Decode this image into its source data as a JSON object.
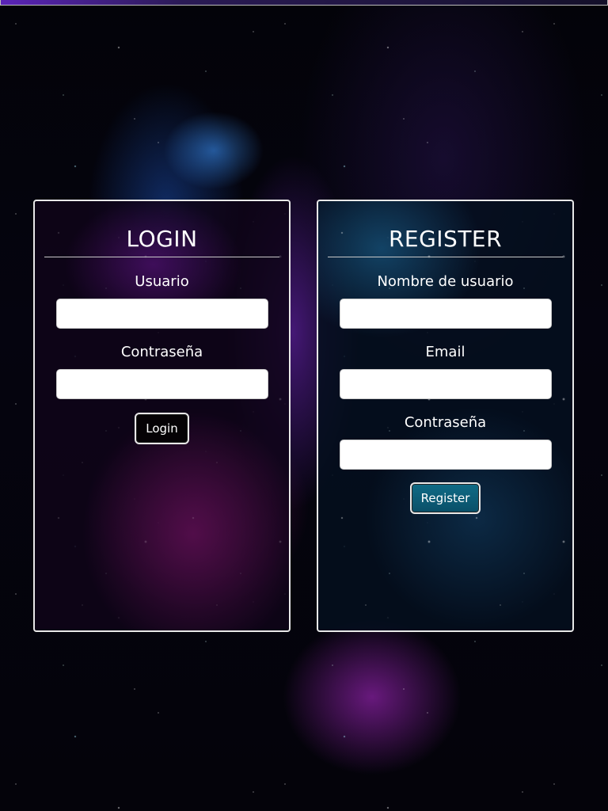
{
  "login": {
    "title": "LOGIN",
    "username_label": "Usuario",
    "username_value": "",
    "password_label": "Contraseña",
    "password_value": "",
    "button_label": "Login"
  },
  "register": {
    "title": "REGISTER",
    "username_label": "Nombre de usuario",
    "username_value": "",
    "email_label": "Email",
    "email_value": "",
    "password_label": "Contraseña",
    "password_value": "",
    "button_label": "Register"
  },
  "colors": {
    "register_button": "#0f6b86",
    "login_button": "#050205",
    "panel_border": "#e8e8e8"
  }
}
